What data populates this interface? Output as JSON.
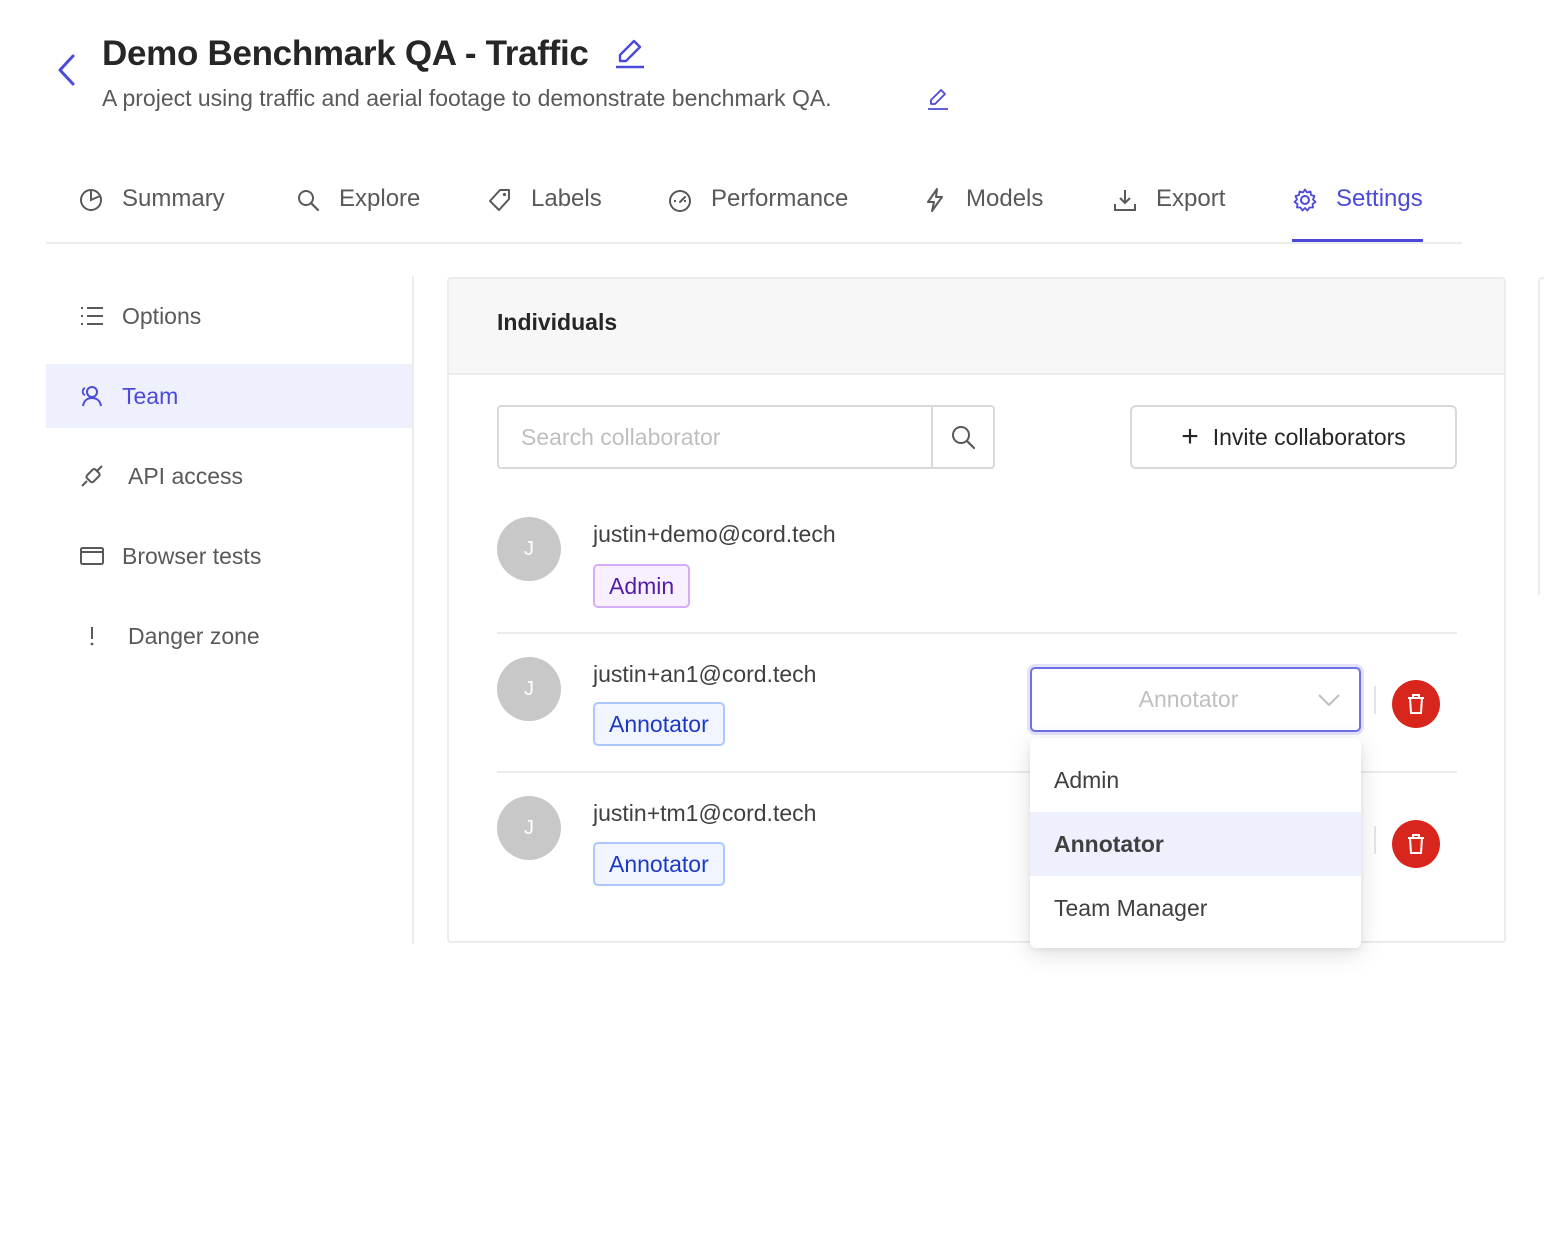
{
  "header": {
    "title": "Demo Benchmark QA - Traffic",
    "subtitle": "A project using traffic and aerial footage to demonstrate benchmark QA."
  },
  "tabs": [
    {
      "label": "Summary",
      "icon": "pie-chart-icon"
    },
    {
      "label": "Explore",
      "icon": "search-icon"
    },
    {
      "label": "Labels",
      "icon": "tag-icon"
    },
    {
      "label": "Performance",
      "icon": "dashboard-icon"
    },
    {
      "label": "Models",
      "icon": "lightning-icon"
    },
    {
      "label": "Export",
      "icon": "download-icon"
    },
    {
      "label": "Settings",
      "icon": "gear-icon",
      "active": true
    }
  ],
  "sidebar": {
    "items": [
      {
        "label": "Options",
        "icon": "list-icon"
      },
      {
        "label": "Team",
        "icon": "team-icon",
        "active": true
      },
      {
        "label": "API access",
        "icon": "api-plug-icon"
      },
      {
        "label": "Browser tests",
        "icon": "browser-window-icon"
      },
      {
        "label": "Danger zone",
        "icon": "exclamation-icon"
      }
    ]
  },
  "individuals": {
    "title": "Individuals",
    "search_placeholder": "Search collaborator",
    "invite_label": "Invite collaborators",
    "members": [
      {
        "initial": "J",
        "email": "justin+demo@cord.tech",
        "role": "Admin"
      },
      {
        "initial": "J",
        "email": "justin+an1@cord.tech",
        "role": "Annotator"
      },
      {
        "initial": "J",
        "email": "justin+tm1@cord.tech",
        "role": "Annotator"
      }
    ],
    "role_select": {
      "value": "Annotator",
      "options": [
        "Admin",
        "Annotator",
        "Team Manager"
      ],
      "selected_option": "Annotator"
    }
  },
  "colors": {
    "accent": "#4b4ad9",
    "delete": "#d9261c",
    "admin_tag": "#531dab",
    "annotator_tag": "#1d39c4"
  }
}
